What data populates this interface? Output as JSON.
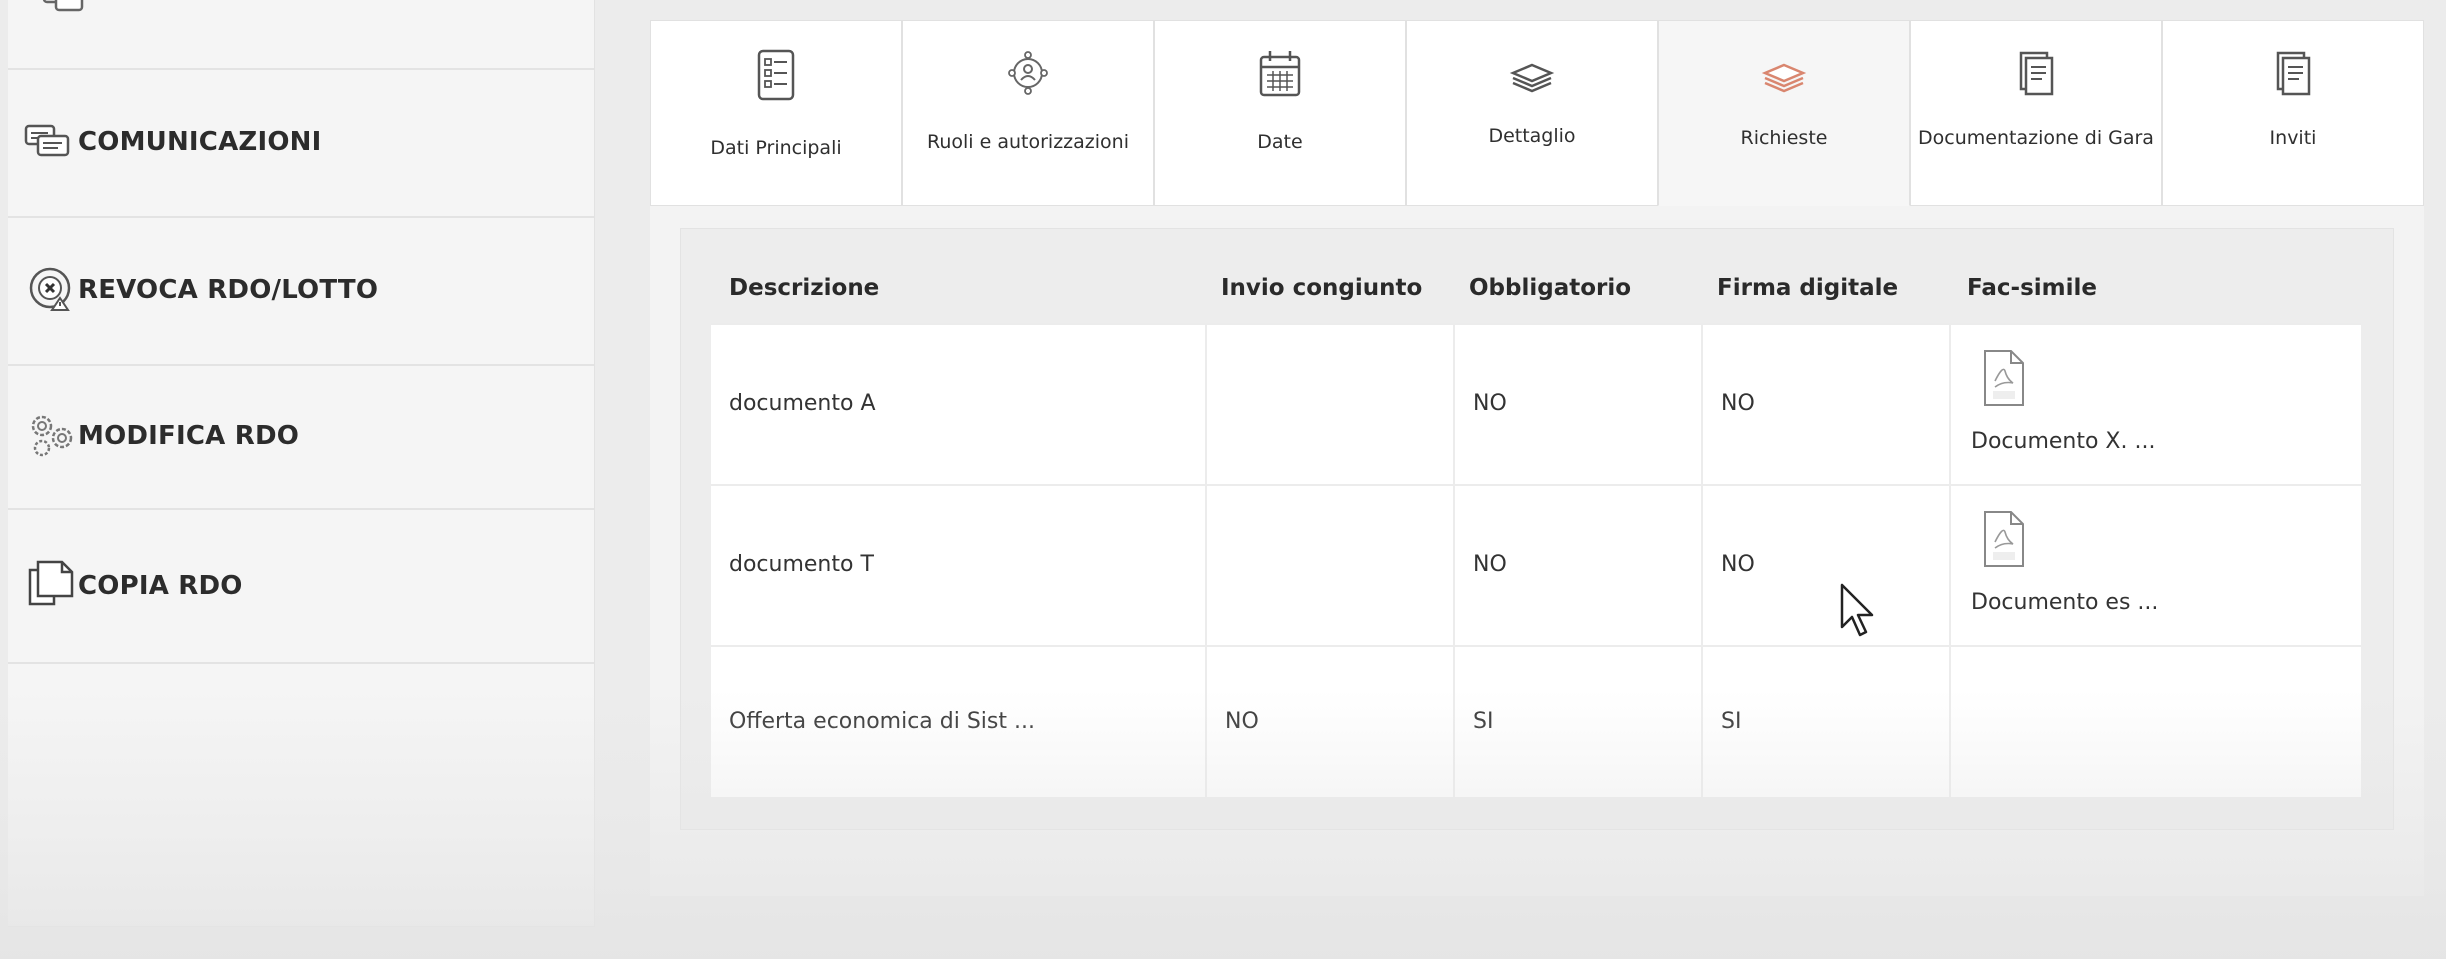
{
  "sidebar": {
    "items": [
      {
        "label": "COMUNICAZIONI",
        "icon": "chat-bubbles-icon"
      },
      {
        "label": "REVOCA RDO/LOTTO",
        "icon": "revoke-icon"
      },
      {
        "label": "MODIFICA RDO",
        "icon": "gears-icon"
      },
      {
        "label": "COPIA RDO",
        "icon": "copy-icon"
      }
    ]
  },
  "tabs": [
    {
      "label": "Dati Principali",
      "icon": "list-document-icon"
    },
    {
      "label": "Ruoli e autorizzazioni",
      "icon": "roles-icon"
    },
    {
      "label": "Date",
      "icon": "calendar-icon"
    },
    {
      "label": "Dettaglio",
      "icon": "layers-icon"
    },
    {
      "label": "Richieste",
      "icon": "layers-icon",
      "active": true
    },
    {
      "label": "Documentazione di Gara",
      "icon": "documents-icon"
    },
    {
      "label": "Inviti",
      "icon": "documents-icon"
    }
  ],
  "colors": {
    "active_tab_icon": "#d9866f",
    "icon_gray": "#555555"
  },
  "table": {
    "headers": [
      "Descrizione",
      "Invio congiunto",
      "Obbligatorio",
      "Firma digitale",
      "Fac-simile"
    ],
    "rows": [
      {
        "descrizione": "documento A",
        "invio_congiunto": "",
        "obbligatorio": "NO",
        "firma_digitale": "NO",
        "fac_simile": "Documento X. ..."
      },
      {
        "descrizione": "documento T",
        "invio_congiunto": "",
        "obbligatorio": "NO",
        "firma_digitale": "NO",
        "fac_simile": "Documento es ..."
      },
      {
        "descrizione": "Offerta economica di Sist ...",
        "invio_congiunto": "NO",
        "obbligatorio": "SI",
        "firma_digitale": "SI",
        "fac_simile": ""
      }
    ]
  }
}
